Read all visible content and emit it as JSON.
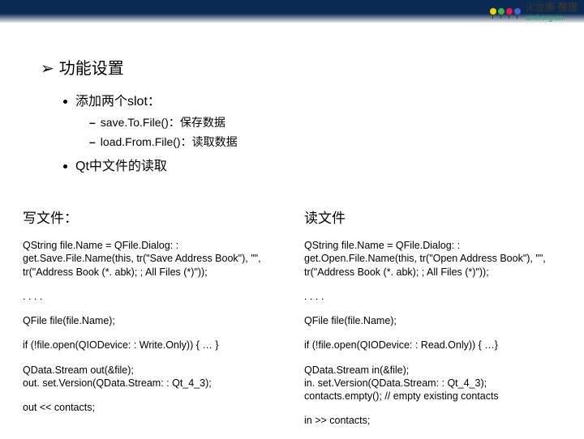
{
  "logo": {
    "text": "火龙果·整理",
    "url": "uml.org.cn"
  },
  "heading": "功能设置",
  "bullets": {
    "b1": "添加两个slot：",
    "s1": "save.To.File()：保存数据",
    "s2": "load.From.File()：读取数据",
    "b2": "Qt中文件的读取"
  },
  "left": {
    "title": "写文件：",
    "p1": "QString file.Name = QFile.Dialog: : get.Save.File.Name(this, tr(\"Save Address Book\"), \"\", tr(\"Address Book (*. abk); ; All Files (*)\"));",
    "p2": ". . . .",
    "p3": "QFile file(file.Name);",
    "p4": "if (!file.open(QIODevice: : Write.Only)) { … }",
    "p5a": "QData.Stream out(&file);",
    "p5b": "out. set.Version(QData.Stream: : Qt_4_3);",
    "p6": "out << contacts;"
  },
  "right": {
    "title": "读文件",
    "p1": "QString file.Name = QFile.Dialog: : get.Open.File.Name(this, tr(\"Open Address Book\"), \"\", tr(\"Address Book (*. abk); ; All Files (*)\"));",
    "p2": ". . . .",
    "p3": "QFile file(file.Name);",
    "p4": "if (!file.open(QIODevice: : Read.Only)) { …}",
    "p5a": "QData.Stream in(&file);",
    "p5b": "in. set.Version(QData.Stream: : Qt_4_3);",
    "p5c": "contacts.empty(); // empty existing contacts",
    "p6": "in >> contacts;"
  }
}
